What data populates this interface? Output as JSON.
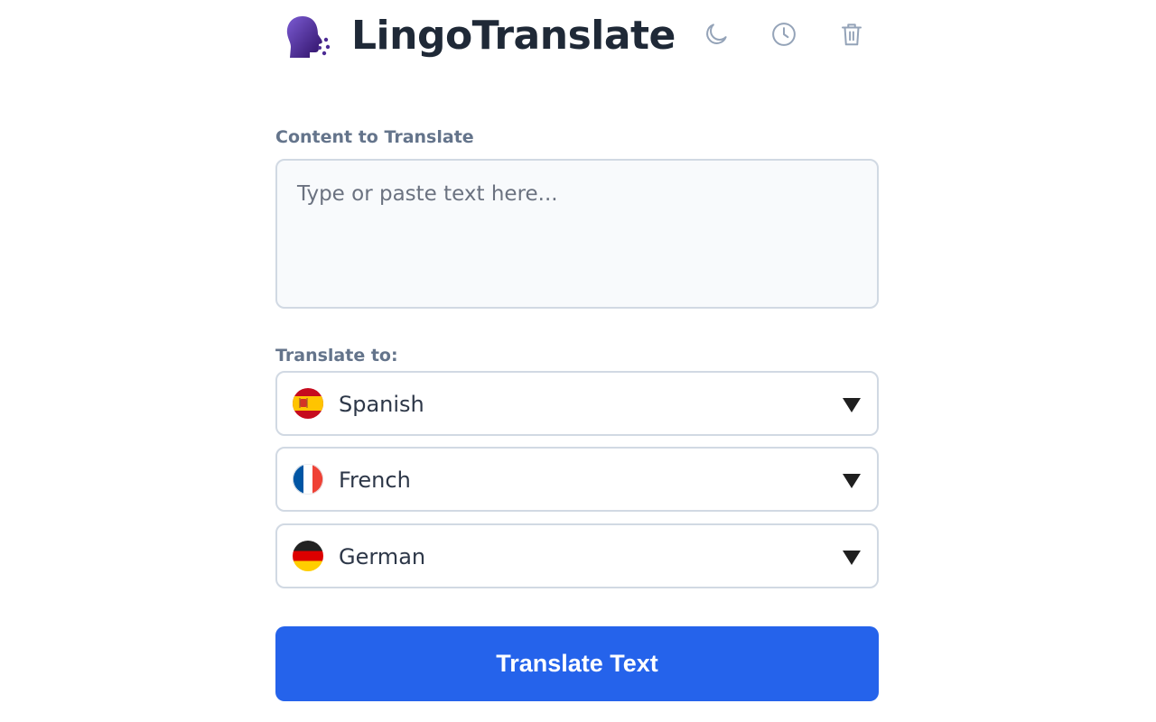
{
  "header": {
    "title": "LingoTranslate",
    "logo_icon": "speaking-head-icon",
    "actions": [
      {
        "name": "dark-mode",
        "icon": "moon-icon"
      },
      {
        "name": "history",
        "icon": "clock-icon"
      },
      {
        "name": "clear",
        "icon": "trash-icon"
      }
    ]
  },
  "input": {
    "label": "Content to Translate",
    "placeholder": "Type or paste text here...",
    "value": ""
  },
  "target": {
    "label": "Translate to:",
    "languages": [
      {
        "name": "Spanish",
        "flag": "spain-flag-icon"
      },
      {
        "name": "French",
        "flag": "france-flag-icon"
      },
      {
        "name": "German",
        "flag": "germany-flag-icon"
      }
    ]
  },
  "submit": {
    "label": "Translate Text"
  },
  "colors": {
    "accent": "#2563eb",
    "label": "#64748b",
    "icon": "#94a3b8",
    "logo_start": "#6d4cc2",
    "logo_end": "#2e1065"
  }
}
